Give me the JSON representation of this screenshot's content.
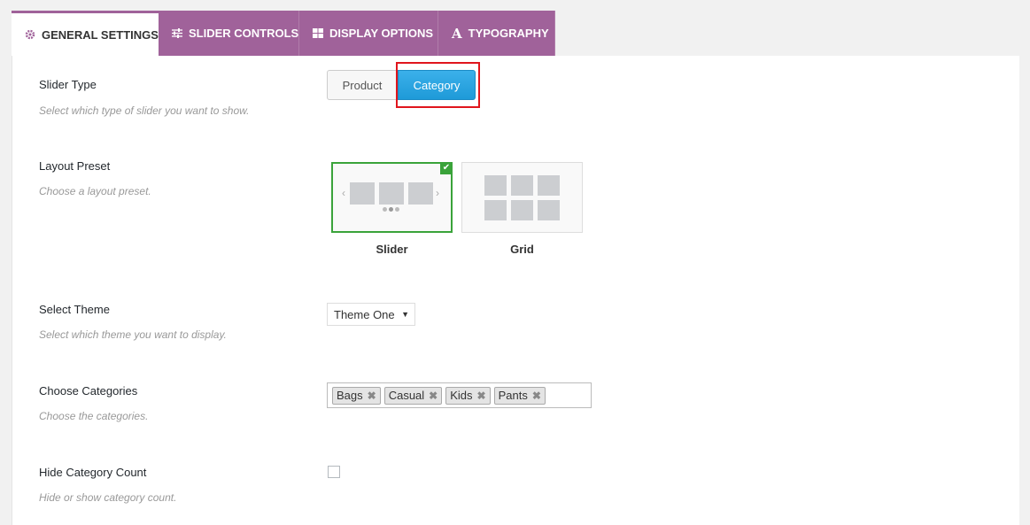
{
  "tabs": [
    {
      "label": "GENERAL SETTINGS",
      "icon": "gear-icon",
      "active": true
    },
    {
      "label": "SLIDER CONTROLS",
      "icon": "sliders-icon",
      "active": false
    },
    {
      "label": "DISPLAY OPTIONS",
      "icon": "grid-icon",
      "active": false
    },
    {
      "label": "TYPOGRAPHY",
      "icon": "font-icon",
      "active": false
    }
  ],
  "settings": {
    "slider_type": {
      "label": "Slider Type",
      "desc": "Select which type of slider you want to show.",
      "options": [
        "Product",
        "Category"
      ],
      "selected": "Category"
    },
    "layout_preset": {
      "label": "Layout Preset",
      "desc": "Choose a layout preset.",
      "options": [
        "Slider",
        "Grid"
      ],
      "selected": "Slider"
    },
    "theme": {
      "label": "Select Theme",
      "desc": "Select which theme you want to display.",
      "value": "Theme One"
    },
    "categories": {
      "label": "Choose Categories",
      "desc": "Choose the categories.",
      "tags": [
        "Bags",
        "Casual",
        "Kids",
        "Pants"
      ]
    },
    "hide_count": {
      "label": "Hide Category Count",
      "desc": "Hide or show category count.",
      "checked": false
    }
  },
  "colors": {
    "tab_bg": "#a0629a",
    "button_active": "#1e9ad8",
    "preset_selected": "#3aa33a",
    "highlight": "#e0151d"
  }
}
